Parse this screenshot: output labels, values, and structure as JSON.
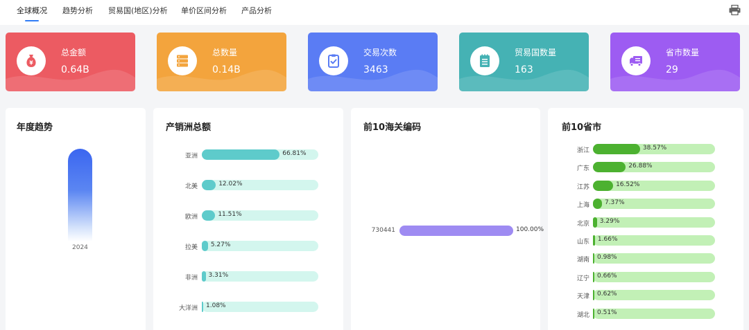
{
  "nav": {
    "tabs": [
      "全球概况",
      "趋势分析",
      "贸易国(地区)分析",
      "单价区间分析",
      "产品分析"
    ],
    "active_tab": 0,
    "print_icon": "printer-icon"
  },
  "stats": [
    {
      "label": "总金额",
      "value": "0.64B",
      "icon": "money-bag-icon",
      "color": "#ec5b62"
    },
    {
      "label": "总数量",
      "value": "0.14B",
      "icon": "server-stack-icon",
      "color": "#f3a43d"
    },
    {
      "label": "交易次数",
      "value": "3463",
      "icon": "clipboard-check-icon",
      "color": "#5a7cf4"
    },
    {
      "label": "贸易国数量",
      "value": "163",
      "icon": "notepad-icon",
      "color": "#45b2b4"
    },
    {
      "label": "省市数量",
      "value": "29",
      "icon": "truck-icon",
      "color": "#9d5cf2"
    }
  ],
  "panels": {
    "trend": {
      "title": "年度趋势",
      "year": "2024"
    },
    "continent": {
      "title": "产销洲总额",
      "items": [
        {
          "label": "亚洲",
          "pct": "66.81%",
          "value": 66.81
        },
        {
          "label": "北美",
          "pct": "12.02%",
          "value": 12.02
        },
        {
          "label": "欧洲",
          "pct": "11.51%",
          "value": 11.51
        },
        {
          "label": "拉美",
          "pct": "5.27%",
          "value": 5.27
        },
        {
          "label": "非洲",
          "pct": "3.31%",
          "value": 3.31
        },
        {
          "label": "大洋洲",
          "pct": "1.08%",
          "value": 1.08
        }
      ]
    },
    "customs": {
      "title": "前10海关编码",
      "items": [
        {
          "label": "730441",
          "pct": "100.00%",
          "value": 100.0
        }
      ]
    },
    "province": {
      "title": "前10省市",
      "items": [
        {
          "label": "浙江",
          "pct": "38.57%",
          "value": 38.57
        },
        {
          "label": "广东",
          "pct": "26.88%",
          "value": 26.88
        },
        {
          "label": "江苏",
          "pct": "16.52%",
          "value": 16.52
        },
        {
          "label": "上海",
          "pct": "7.37%",
          "value": 7.37
        },
        {
          "label": "北京",
          "pct": "3.29%",
          "value": 3.29
        },
        {
          "label": "山东",
          "pct": "1.66%",
          "value": 1.66
        },
        {
          "label": "湖南",
          "pct": "0.98%",
          "value": 0.98
        },
        {
          "label": "辽宁",
          "pct": "0.66%",
          "value": 0.66
        },
        {
          "label": "天津",
          "pct": "0.62%",
          "value": 0.62
        },
        {
          "label": "湖北",
          "pct": "0.51%",
          "value": 0.51
        }
      ]
    }
  },
  "colors": {
    "continent_fill": "#5ecbcb",
    "continent_track": "#d3f6ee",
    "customs_fill": "#9e8bf2",
    "province_fill": "#4cb130",
    "province_track": "#c2f0b6",
    "accent": "#2f7cf6"
  }
}
